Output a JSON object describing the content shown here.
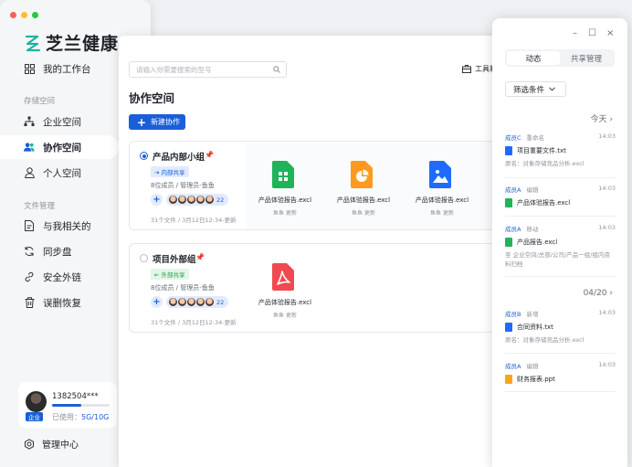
{
  "window_dots": [
    "#ff5f57",
    "#febc2e",
    "#28c840"
  ],
  "brand": {
    "name": "芝兰健康",
    "logo_icon": "orchid-logo-icon"
  },
  "sidebar": {
    "workbench": "我的工作台",
    "section_storage": "存储空间",
    "storage_items": [
      "企业空间",
      "协作空间",
      "个人空间"
    ],
    "section_files": "文件管理",
    "file_items": [
      "与我相关的",
      "同步盘",
      "安全外链",
      "误删恢复"
    ],
    "active_item": "协作空间"
  },
  "user": {
    "id": "1382504***",
    "badge": "企业",
    "usage_prefix": "已使用：",
    "usage_value": "5G/10G",
    "usage_fraction": 0.5
  },
  "admin_label": "管理中心",
  "main": {
    "search_placeholder": "请输入你需要搜索的型号",
    "toolbox_label": "工具箱",
    "title": "协作空间",
    "new_button": "新建协作",
    "groups": [
      {
        "name": "产品内部小组",
        "selected": true,
        "tag": "内部共享",
        "members": "8位成员 / 管理员-鱼鱼",
        "count": "22",
        "meta": "31个文件 / 3月12日12:34-更新",
        "files": [
          {
            "name": "产品体验报告.excl",
            "sub": "鱼鱼 更新",
            "type": "sheet"
          },
          {
            "name": "产品体验报告.excl",
            "sub": "鱼鱼 更新",
            "type": "chart"
          },
          {
            "name": "产品体验报告.excl",
            "sub": "鱼鱼 更新",
            "type": "image"
          }
        ]
      },
      {
        "name": "项目外部组",
        "selected": false,
        "tag": "外部共享",
        "members": "8位成员 / 管理员-鱼鱼",
        "count": "22",
        "meta": "31个文件 / 3月12日12:34-更新",
        "files": [
          {
            "name": "产品体验报告.excl",
            "sub": "鱼鱼 更新",
            "type": "pdf"
          }
        ]
      }
    ]
  },
  "panel": {
    "tabs": [
      "动态",
      "共享管理"
    ],
    "active_tab": "动态",
    "filter": "筛选条件",
    "date_today": "今天",
    "date_other": "04/20",
    "activities": [
      {
        "user": "成员C",
        "action": "重命名",
        "time": "14:03",
        "file": "项目重要文件.txt",
        "file_type": "doc",
        "note": "原名：对象存储竞品分析.excl"
      },
      {
        "user": "成员A",
        "action": "编辑",
        "time": "14:03",
        "file": "产品体验报告.excl",
        "file_type": "sheet",
        "note": ""
      },
      {
        "user": "成员A",
        "action": "移动",
        "time": "14:03",
        "file": "产品报告.excl",
        "file_type": "sheet",
        "note": "至 企业空间/总部/公司/产品一组/组内资料归档"
      },
      {
        "user": "成员B",
        "action": "新增",
        "time": "14:03",
        "file": "合同资料.txt",
        "file_type": "doc",
        "note": "原名：对象存储竞品分析.excl"
      },
      {
        "user": "成员A",
        "action": "编辑",
        "time": "14:03",
        "file": "财务报表.ppt",
        "file_type": "ppt",
        "note": ""
      }
    ]
  },
  "colors": {
    "accent": "#1a5fd8",
    "sheet": "#1fb35b",
    "chart": "#ff9a1f",
    "image": "#1f6bff",
    "pdf": "#f0494f",
    "ppt": "#ffa21a"
  }
}
